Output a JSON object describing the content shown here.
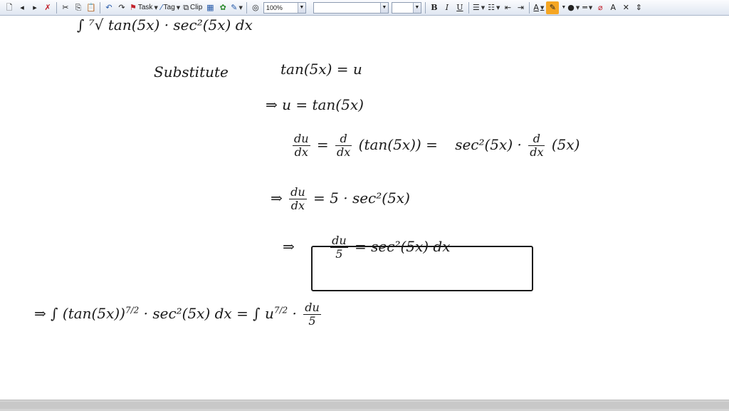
{
  "toolbar": {
    "task_label": "Task",
    "tag_label": "Tag",
    "clip_label": "Clip",
    "zoom_value": "100%",
    "bold_label": "B",
    "italic_label": "I",
    "underline_label": "U",
    "font_color_label": "A",
    "styles_label": "A"
  },
  "work": {
    "line1": "∫ ⁷√ tan(5x) · sec²(5x) dx",
    "line2_word": "Substitute",
    "line2_expr": "tan(5x) = u",
    "line3": "⇒ u = tan(5x)",
    "line4_lhs_num": "du",
    "line4_lhs_den": "dx",
    "line4_eq": "=",
    "line4_op_num": "d",
    "line4_op_den": "dx",
    "line4_mid": "(tan(5x)) =",
    "line4_rhs": "sec²(5x) ·",
    "line4_rhs_num": "d",
    "line4_rhs_den": "dx",
    "line4_tail": "(5x)",
    "line5_prefix": "⇒",
    "line5_num": "du",
    "line5_den": "dx",
    "line5_rhs": "= 5 · sec²(5x)",
    "line6_prefix": "⇒",
    "line6_num": "du",
    "line6_den": "5",
    "line6_rhs": "= sec²(5x) dx",
    "line7_lhs": "⇒ ∫ (tan(5x))",
    "line7_exp": "7/2",
    "line7_mid": "· sec²(5x) dx  =  ∫ u",
    "line7_exp2": "7/2",
    "line7_dot": "·",
    "line7_num": "du",
    "line7_den": "5"
  },
  "colors": {
    "toolbar_top": "#fbfcfe",
    "toolbar_bottom": "#dfe6f1",
    "ink": "#1a1a1a",
    "scrollbar": "#d4d4d4"
  }
}
